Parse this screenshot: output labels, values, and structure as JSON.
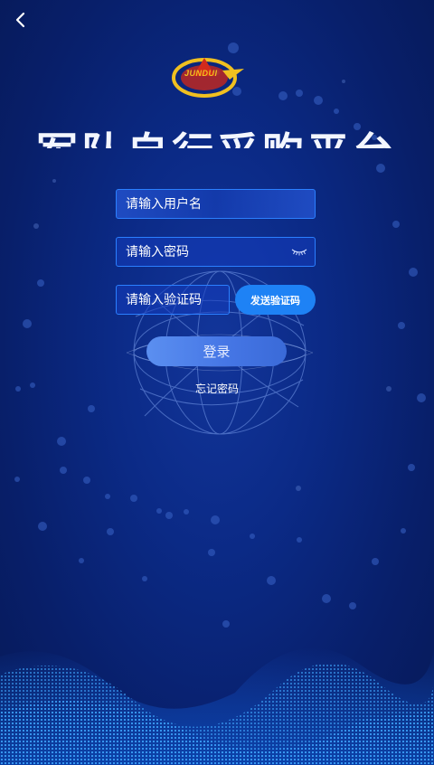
{
  "header": {
    "back_icon": "chevron-left-icon"
  },
  "logo": {
    "text": "JUNDUI",
    "icon": "logo-emblem"
  },
  "title": "军队自行采购平台",
  "form": {
    "username": {
      "placeholder": "请输入用户名",
      "value": ""
    },
    "password": {
      "placeholder": "请输入密码",
      "value": "",
      "toggle_icon": "eye-closed-icon"
    },
    "code": {
      "placeholder": "请输入验证码",
      "value": ""
    },
    "send_code_label": "发送验证码",
    "login_label": "登录",
    "forgot_label": "忘记密码"
  },
  "colors": {
    "background": "#0b2a86",
    "field_border": "#2b7fff",
    "send_button": "#1e82f5",
    "login_button": "#4677e6",
    "logo_gold": "#f0c020"
  }
}
